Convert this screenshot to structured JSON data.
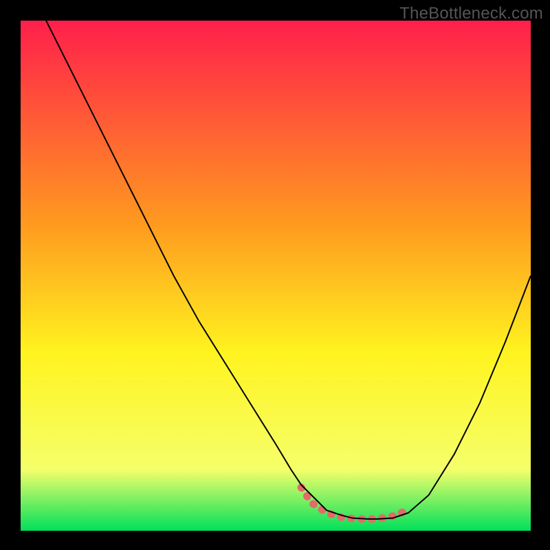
{
  "watermark": "TheBottleneck.com",
  "chart_data": {
    "type": "line",
    "title": "",
    "xlabel": "",
    "ylabel": "",
    "xlim": [
      0,
      100
    ],
    "ylim": [
      0,
      100
    ],
    "background_gradient": {
      "top_color": "#ff1f4b",
      "mid1_color": "#ff9a1f",
      "mid2_color": "#fff31f",
      "mid3_color": "#f5ff6a",
      "bottom_color": "#00e05a"
    },
    "series": [
      {
        "name": "bottleneck-curve",
        "stroke": "#000000",
        "x": [
          5,
          10,
          15,
          20,
          25,
          30,
          35,
          40,
          45,
          50,
          53,
          55,
          58,
          60,
          63,
          65,
          68,
          70,
          73,
          76,
          80,
          85,
          90,
          95,
          100
        ],
        "y": [
          100,
          90,
          80,
          70,
          60,
          50,
          41,
          33,
          25,
          17,
          12,
          9,
          6,
          4,
          3,
          2.5,
          2.3,
          2.3,
          2.5,
          3.5,
          7,
          15,
          25,
          37,
          50
        ]
      },
      {
        "name": "optimal-zone-marker",
        "stroke": "#e46a6a",
        "stroke_width": 8,
        "x": [
          55,
          57,
          60,
          63,
          66,
          69,
          72,
          74,
          76
        ],
        "y": [
          8.5,
          5.5,
          3.5,
          2.6,
          2.3,
          2.3,
          2.6,
          3.2,
          4.2
        ]
      }
    ]
  }
}
